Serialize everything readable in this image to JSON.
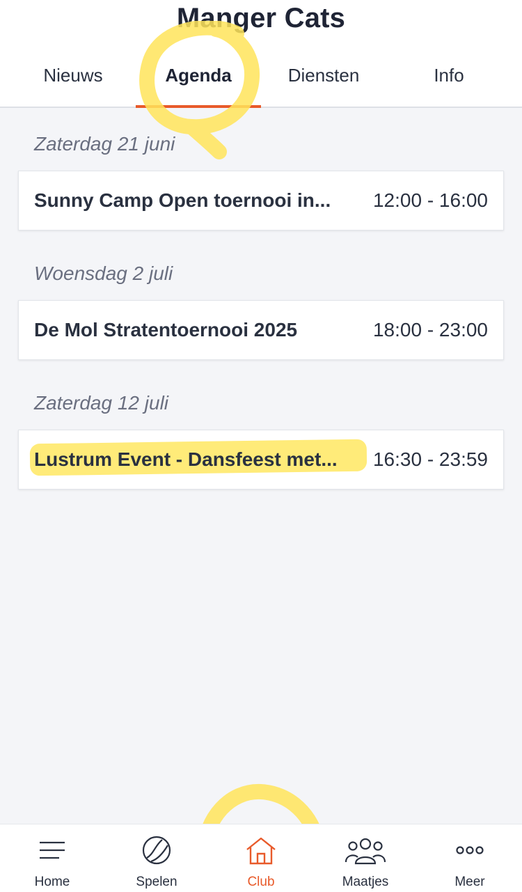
{
  "header": {
    "title": "Manger Cats",
    "tabs": [
      {
        "label": "Nieuws",
        "active": false
      },
      {
        "label": "Agenda",
        "active": true
      },
      {
        "label": "Diensten",
        "active": false
      },
      {
        "label": "Info",
        "active": false
      }
    ]
  },
  "agenda": [
    {
      "date": "Zaterdag 21 juni",
      "title": "Sunny Camp Open toernooi in...",
      "time": "12:00 - 16:00"
    },
    {
      "date": "Woensdag 2 juli",
      "title": "De Mol Stratentoernooi 2025",
      "time": "18:00 - 23:00"
    },
    {
      "date": "Zaterdag 12 juli",
      "title": "Lustrum Event - Dansfeest met...",
      "time": "16:30 - 23:59"
    }
  ],
  "bottom_nav": [
    {
      "label": "Home",
      "icon": "menu-icon",
      "active": false
    },
    {
      "label": "Spelen",
      "icon": "tennis-ball-icon",
      "active": false
    },
    {
      "label": "Club",
      "icon": "house-icon",
      "active": true
    },
    {
      "label": "Maatjes",
      "icon": "people-icon",
      "active": false
    },
    {
      "label": "Meer",
      "icon": "more-dots-icon",
      "active": false
    }
  ],
  "colors": {
    "accent": "#e85a2a",
    "text": "#2a3140",
    "background": "#f4f5f8",
    "highlighter": "#ffe96a"
  }
}
